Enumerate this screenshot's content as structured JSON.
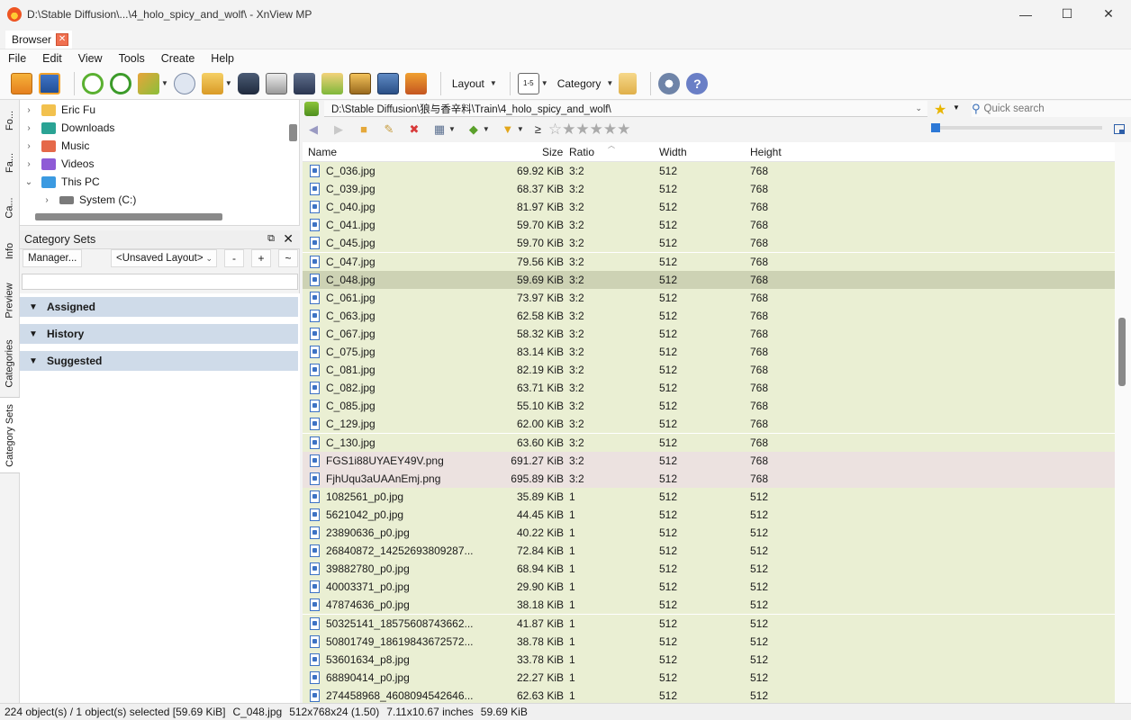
{
  "window": {
    "title": "D:\\Stable Diffusion\\...\\4_holo_spicy_and_wolf\\ - XnView MP",
    "minimize": "—",
    "maximize": "☐",
    "close": "✕"
  },
  "tabs": [
    {
      "label": "Browser",
      "close": "✕"
    }
  ],
  "menu": [
    "File",
    "Edit",
    "View",
    "Tools",
    "Create",
    "Help"
  ],
  "toolbar": {
    "layout_label": "Layout",
    "category_label": "Category",
    "page_label": "1-5"
  },
  "vertical_tabs": [
    "Fo...",
    "Fa...",
    "Ca...",
    "Info",
    "Preview",
    "Categories",
    "Category Sets"
  ],
  "tree": {
    "items": [
      {
        "label": "Eric Fu",
        "arrow": "›",
        "icon_color": "#f2c14e"
      },
      {
        "label": "Downloads",
        "arrow": "›",
        "icon_color": "#2aa394"
      },
      {
        "label": "Music",
        "arrow": "›",
        "icon_color": "#e5694a"
      },
      {
        "label": "Videos",
        "arrow": "›",
        "icon_color": "#8e5bd6"
      },
      {
        "label": "This PC",
        "arrow": "⌄",
        "icon_color": "#3b9ae1"
      },
      {
        "label": "System (C:)",
        "arrow": "›",
        "icon_color": "#7a7a7a"
      }
    ]
  },
  "category_sets": {
    "title": "Category Sets",
    "float_icon": "⧉",
    "close_icon": "✕",
    "manager_button": "Manager...",
    "layout_select": "<Unsaved Layout>",
    "minus": "-",
    "plus": "+",
    "tilde": "~",
    "groups": [
      "Assigned",
      "History",
      "Suggested"
    ]
  },
  "address": {
    "path": "D:\\Stable Diffusion\\狼与香辛料\\Train\\4_holo_spicy_and_wolf\\",
    "quick_search_placeholder": "Quick search"
  },
  "nav": {
    "rating_op": "≥"
  },
  "columns": {
    "name": "Name",
    "size": "Size",
    "ratio": "Ratio",
    "width": "Width",
    "height": "Height"
  },
  "files": [
    {
      "name": "C_036.jpg",
      "size": "69.92 KiB",
      "ratio": "3:2",
      "width": "512",
      "height": "768",
      "type": "jpg"
    },
    {
      "name": "C_039.jpg",
      "size": "68.37 KiB",
      "ratio": "3:2",
      "width": "512",
      "height": "768",
      "type": "jpg"
    },
    {
      "name": "C_040.jpg",
      "size": "81.97 KiB",
      "ratio": "3:2",
      "width": "512",
      "height": "768",
      "type": "jpg"
    },
    {
      "name": "C_041.jpg",
      "size": "59.70 KiB",
      "ratio": "3:2",
      "width": "512",
      "height": "768",
      "type": "jpg"
    },
    {
      "name": "C_045.jpg",
      "size": "59.70 KiB",
      "ratio": "3:2",
      "width": "512",
      "height": "768",
      "type": "jpg"
    },
    {
      "name": "C_047.jpg",
      "size": "79.56 KiB",
      "ratio": "3:2",
      "width": "512",
      "height": "768",
      "type": "jpg"
    },
    {
      "name": "C_048.jpg",
      "size": "59.69 KiB",
      "ratio": "3:2",
      "width": "512",
      "height": "768",
      "type": "sel"
    },
    {
      "name": "C_061.jpg",
      "size": "73.97 KiB",
      "ratio": "3:2",
      "width": "512",
      "height": "768",
      "type": "jpg"
    },
    {
      "name": "C_063.jpg",
      "size": "62.58 KiB",
      "ratio": "3:2",
      "width": "512",
      "height": "768",
      "type": "jpg"
    },
    {
      "name": "C_067.jpg",
      "size": "58.32 KiB",
      "ratio": "3:2",
      "width": "512",
      "height": "768",
      "type": "jpg"
    },
    {
      "name": "C_075.jpg",
      "size": "83.14 KiB",
      "ratio": "3:2",
      "width": "512",
      "height": "768",
      "type": "jpg"
    },
    {
      "name": "C_081.jpg",
      "size": "82.19 KiB",
      "ratio": "3:2",
      "width": "512",
      "height": "768",
      "type": "jpg"
    },
    {
      "name": "C_082.jpg",
      "size": "63.71 KiB",
      "ratio": "3:2",
      "width": "512",
      "height": "768",
      "type": "jpg"
    },
    {
      "name": "C_085.jpg",
      "size": "55.10 KiB",
      "ratio": "3:2",
      "width": "512",
      "height": "768",
      "type": "jpg"
    },
    {
      "name": "C_129.jpg",
      "size": "62.00 KiB",
      "ratio": "3:2",
      "width": "512",
      "height": "768",
      "type": "jpg"
    },
    {
      "name": "C_130.jpg",
      "size": "63.60 KiB",
      "ratio": "3:2",
      "width": "512",
      "height": "768",
      "type": "jpg"
    },
    {
      "name": "FGS1i88UYAEY49V.png",
      "size": "691.27 KiB",
      "ratio": "3:2",
      "width": "512",
      "height": "768",
      "type": "png"
    },
    {
      "name": "FjhUqu3aUAAnEmj.png",
      "size": "695.89 KiB",
      "ratio": "3:2",
      "width": "512",
      "height": "768",
      "type": "png"
    },
    {
      "name": "1082561_p0.jpg",
      "size": "35.89 KiB",
      "ratio": "1",
      "width": "512",
      "height": "512",
      "type": "jpg"
    },
    {
      "name": "5621042_p0.jpg",
      "size": "44.45 KiB",
      "ratio": "1",
      "width": "512",
      "height": "512",
      "type": "jpg"
    },
    {
      "name": "23890636_p0.jpg",
      "size": "40.22 KiB",
      "ratio": "1",
      "width": "512",
      "height": "512",
      "type": "jpg"
    },
    {
      "name": "26840872_14252693809287...",
      "size": "72.84 KiB",
      "ratio": "1",
      "width": "512",
      "height": "512",
      "type": "jpg"
    },
    {
      "name": "39882780_p0.jpg",
      "size": "68.94 KiB",
      "ratio": "1",
      "width": "512",
      "height": "512",
      "type": "jpg"
    },
    {
      "name": "40003371_p0.jpg",
      "size": "29.90 KiB",
      "ratio": "1",
      "width": "512",
      "height": "512",
      "type": "jpg"
    },
    {
      "name": "47874636_p0.jpg",
      "size": "38.18 KiB",
      "ratio": "1",
      "width": "512",
      "height": "512",
      "type": "jpg"
    },
    {
      "name": "50325141_18575608743662...",
      "size": "41.87 KiB",
      "ratio": "1",
      "width": "512",
      "height": "512",
      "type": "jpg"
    },
    {
      "name": "50801749_18619843672572...",
      "size": "38.78 KiB",
      "ratio": "1",
      "width": "512",
      "height": "512",
      "type": "jpg"
    },
    {
      "name": "53601634_p8.jpg",
      "size": "33.78 KiB",
      "ratio": "1",
      "width": "512",
      "height": "512",
      "type": "jpg"
    },
    {
      "name": "68890414_p0.jpg",
      "size": "22.27 KiB",
      "ratio": "1",
      "width": "512",
      "height": "512",
      "type": "jpg"
    },
    {
      "name": "274458968_4608094542646...",
      "size": "62.63 KiB",
      "ratio": "1",
      "width": "512",
      "height": "512",
      "type": "jpg"
    }
  ],
  "status": {
    "objects": "224 object(s) / 1 object(s) selected [59.69 KiB]",
    "file": "C_048.jpg",
    "dims": "512x768x24 (1.50)",
    "inches": "7.11x10.67 inches",
    "size": "59.69 KiB"
  }
}
